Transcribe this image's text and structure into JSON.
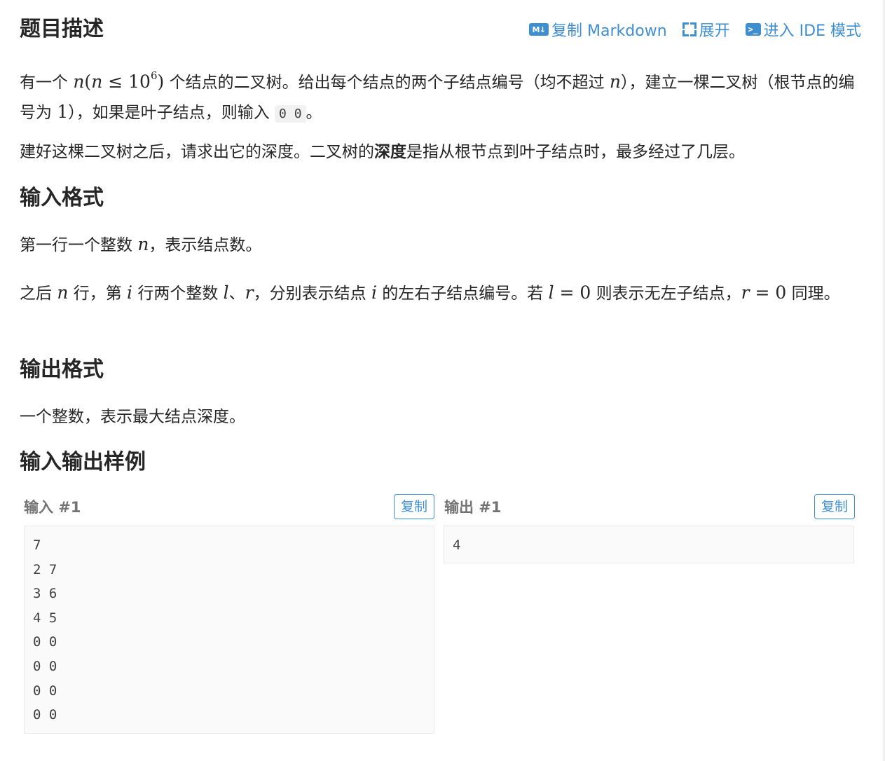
{
  "header": {
    "title": "题目描述",
    "actions": {
      "markdown_icon": "M↓",
      "copy_markdown": "复制 Markdown",
      "expand": "展开",
      "ide_icon": ">_",
      "ide_mode": "进入 IDE 模式"
    }
  },
  "description": {
    "p1": {
      "t1": "有一个 ",
      "n1": "n",
      "paren_open": "(",
      "n2": "n",
      "leq": " ≤ ",
      "ten": "10",
      "exp": "6",
      "paren_close": ")",
      "t2": " 个结点的二叉树。给出每个结点的两个子结点编号（均不超过 ",
      "n3": "n",
      "t3": "），建立一棵二叉树（根节点的编号为 ",
      "one": "1",
      "t4": "），如果是叶子结点，则输入 ",
      "code": "0 0",
      "t5": "。"
    },
    "p2": {
      "t1": "建好这棵二叉树之后，请求出它的深度。二叉树的",
      "strong": "深度",
      "t2": "是指从根节点到叶子结点时，最多经过了几层。"
    }
  },
  "input_format": {
    "title": "输入格式",
    "p1": {
      "t1": "第一行一个整数 ",
      "n": "n",
      "t2": "，表示结点数。"
    },
    "p2": {
      "t1": "之后 ",
      "n": "n",
      "t2": " 行，第 ",
      "i1": "i",
      "t3": " 行两个整数 ",
      "l": "l",
      "t4": "、",
      "r": "r",
      "t5": "，分别表示结点 ",
      "i2": "i",
      "t6": " 的左右子结点编号。若 ",
      "l2": "l",
      "eq1": " = 0",
      "t7": " 则表示无左子结点，",
      "r2": "r",
      "eq2": " = 0",
      "t8": " 同理。"
    }
  },
  "output_format": {
    "title": "输出格式",
    "p1": "一个整数，表示最大结点深度。"
  },
  "samples": {
    "title": "输入输出样例",
    "input_label": "输入 #1",
    "output_label": "输出 #1",
    "copy": "复制",
    "input_text": "7\n2 7\n3 6\n4 5\n0 0\n0 0\n0 0\n0 0",
    "output_text": "4"
  },
  "colors": {
    "accent": "#3e8ed0",
    "text": "#262626",
    "muted": "#737373",
    "code_bg": "#fafafa"
  }
}
